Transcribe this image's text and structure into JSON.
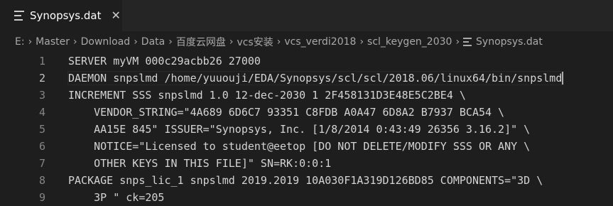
{
  "tab": {
    "title": "Synopsys.dat",
    "close": "✕"
  },
  "breadcrumb": [
    "E:",
    "Master",
    "Download",
    "Data",
    "百度云网盘",
    "vcs安装",
    "vcs_verdi2018",
    "scl_keygen_2030",
    "Synopsys.dat"
  ],
  "editor": {
    "active_line": 2,
    "lines": [
      {
        "num": "1",
        "text": "SERVER myVM 000c29acbb26 27000"
      },
      {
        "num": "2",
        "text": "DAEMON snpslmd /home/yuuouji/EDA/Synopsys/scl/scl/2018.06/linux64/bin/snpslmd"
      },
      {
        "num": "3",
        "text": "INCREMENT SSS snpslmd 1.0 12-dec-2030 1 2F458131D3E48E5C2BE4 \\"
      },
      {
        "num": "4",
        "text": "    VENDOR_STRING=\"4A689 6D6C7 93351 C8FDB A0A47 6D8A2 B7937 BCA54 \\"
      },
      {
        "num": "5",
        "text": "    AA15E 845\" ISSUER=\"Synopsys, Inc. [1/8/2014 0:43:49 26356 3.16.2]\" \\"
      },
      {
        "num": "6",
        "text": "    NOTICE=\"Licensed to student@eetop [DO NOT DELETE/MODIFY SSS OR ANY \\"
      },
      {
        "num": "7",
        "text": "    OTHER KEYS IN THIS FILE]\" SN=RK:0:0:1"
      },
      {
        "num": "8",
        "text": "PACKAGE snps_lic_1 snpslmd 2019.2019 10A030F1A319D126BD85 COMPONENTS=\"3D \\"
      },
      {
        "num": "9",
        "text": "    3P \" ck=205"
      }
    ]
  }
}
